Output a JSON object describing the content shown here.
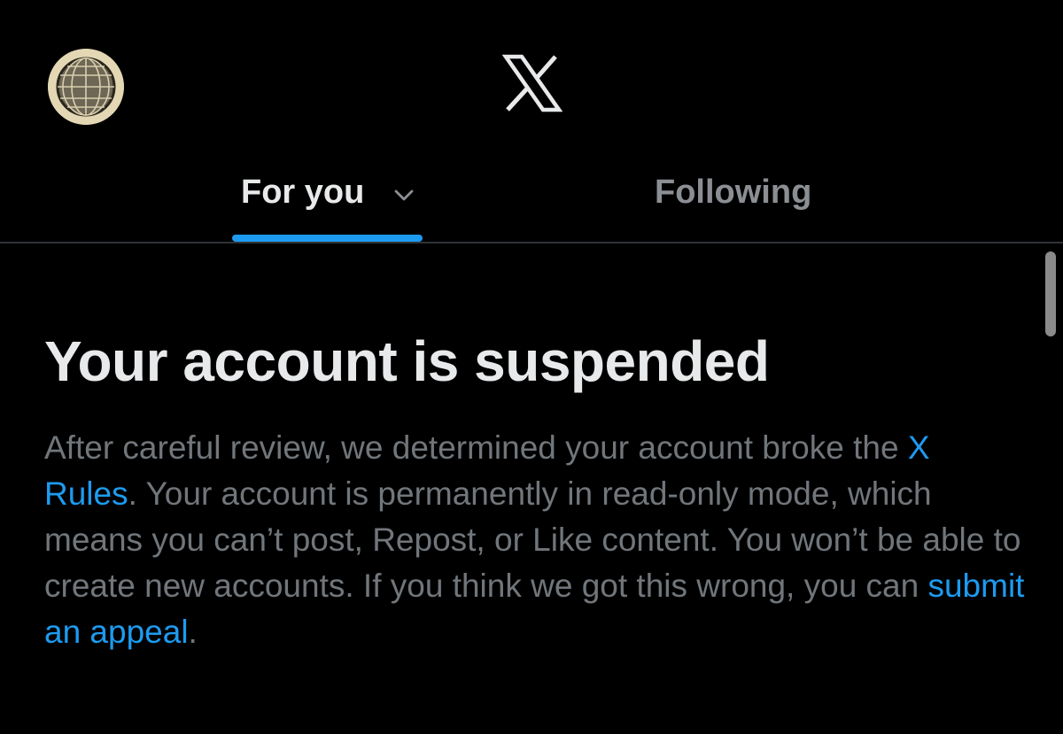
{
  "header": {
    "logo": "X"
  },
  "tabs": [
    {
      "label": "For you",
      "selected": true
    },
    {
      "label": "Following",
      "selected": false
    }
  ],
  "notice": {
    "title": "Your account is suspended",
    "body_intro": "After careful review, we determined your account broke the ",
    "rules_link": "X Rules",
    "body_middle": ". Your account is permanently in read-only mode, which means you can’t post, Repost, or Like content. You won’t be able to create new accounts. If you think we got this wrong, you can ",
    "appeal_link": "submit an appeal",
    "body_end": "."
  },
  "icons": {
    "avatar": "globe-avatar",
    "logo": "x-logo-icon",
    "tab_menu": "chevron-down-icon"
  },
  "colors": {
    "background": "#000000",
    "primary_text": "#e7e9ea",
    "secondary_text": "#71767b",
    "accent": "#1d9bf0",
    "divider": "#2f3336"
  }
}
